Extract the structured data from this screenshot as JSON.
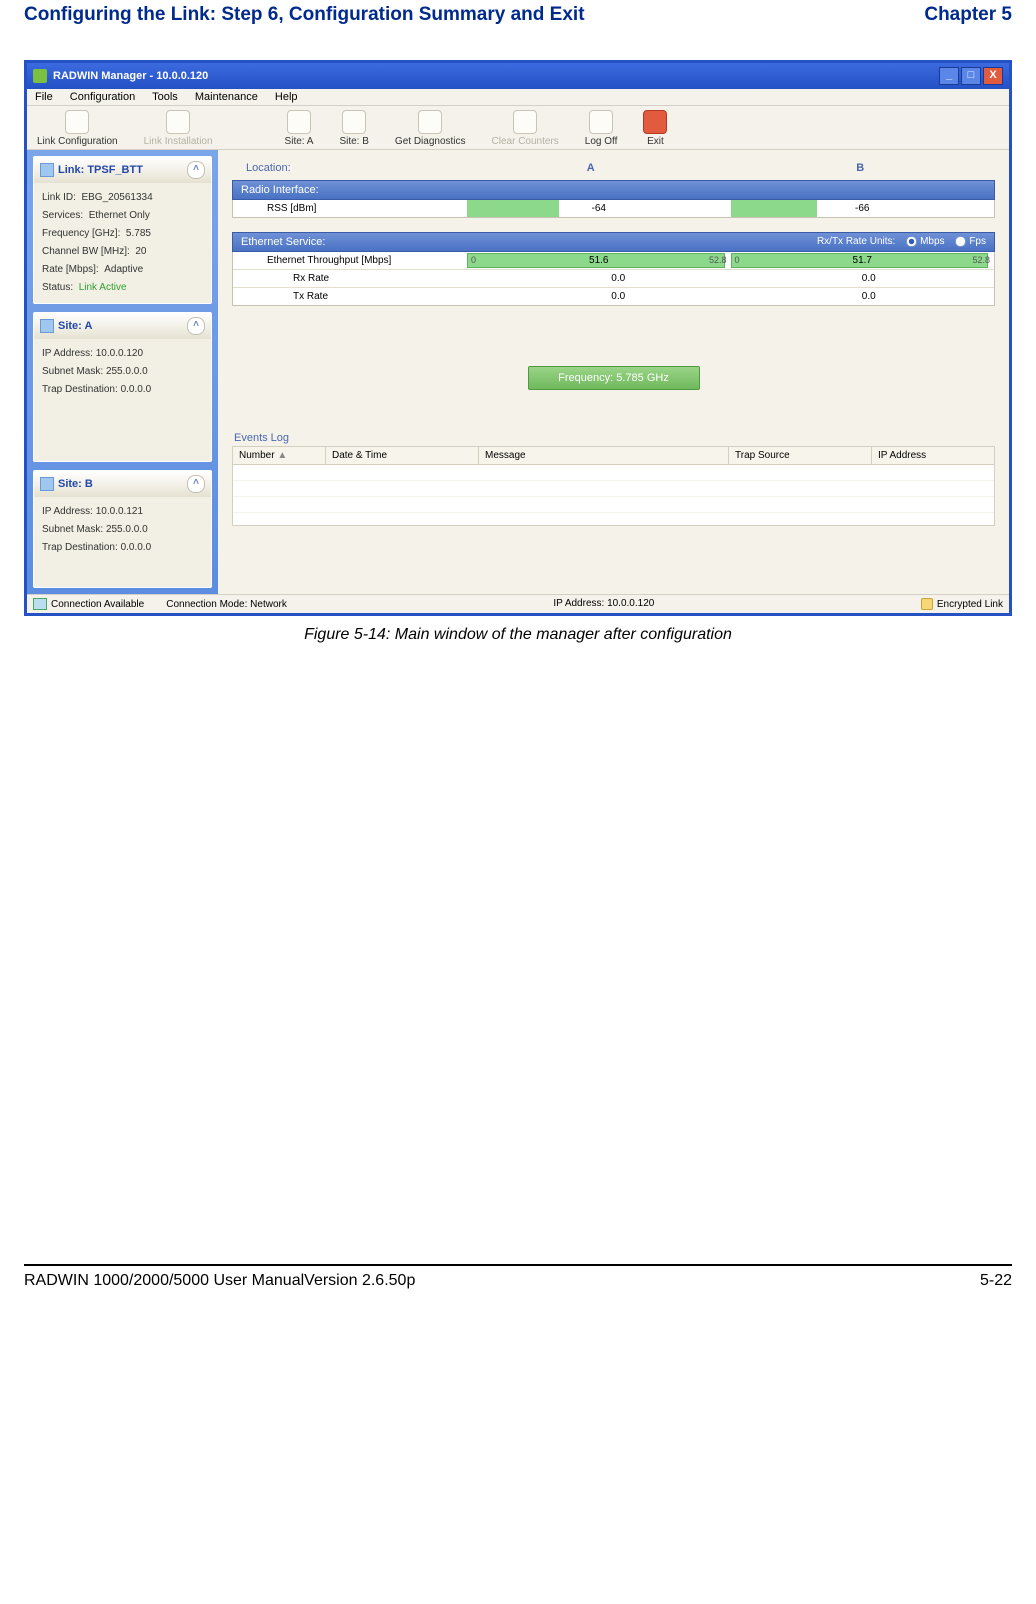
{
  "header": {
    "left": "Configuring the Link: Step 6, Configuration Summary and Exit",
    "right": "Chapter 5"
  },
  "titlebar": {
    "text": "RADWIN Manager - 10.0.0.120"
  },
  "winbtns": {
    "min": "_",
    "max": "□",
    "close": "X"
  },
  "menu": {
    "file": "File",
    "config": "Configuration",
    "tools": "Tools",
    "maint": "Maintenance",
    "help": "Help"
  },
  "toolbar": {
    "linkconf": "Link Configuration",
    "linkinst": "Link Installation",
    "sitea": "Site: A",
    "siteb": "Site: B",
    "getdiag": "Get Diagnostics",
    "clearcnt": "Clear Counters",
    "logoff": "Log Off",
    "exit": "Exit"
  },
  "panelLink": {
    "title": "Link: TPSF_BTT",
    "rows": {
      "id_l": "Link ID:",
      "id_v": "EBG_20561334",
      "svc_l": "Services:",
      "svc_v": "Ethernet Only",
      "freq_l": "Frequency [GHz]:",
      "freq_v": "5.785",
      "bw_l": "Channel BW [MHz]:",
      "bw_v": "20",
      "rate_l": "Rate [Mbps]:",
      "rate_v": "Adaptive",
      "stat_l": "Status:",
      "stat_v": "Link Active"
    }
  },
  "panelA": {
    "title": "Site: A",
    "rows": {
      "ip_l": "IP Address:",
      "ip_v": "10.0.0.120",
      "sm_l": "Subnet Mask:",
      "sm_v": "255.0.0.0",
      "td_l": "Trap Destination:",
      "td_v": "0.0.0.0"
    }
  },
  "panelB": {
    "title": "Site: B",
    "rows": {
      "ip_l": "IP Address:",
      "ip_v": "10.0.0.121",
      "sm_l": "Subnet Mask:",
      "sm_v": "255.0.0.0",
      "td_l": "Trap Destination:",
      "td_v": "0.0.0.0"
    }
  },
  "loc": {
    "label": "Location:",
    "a": "A",
    "b": "B"
  },
  "radio": {
    "head": "Radio Interface:",
    "rss_l": "RSS [dBm]",
    "rss_a": "-64",
    "rss_b": "-66"
  },
  "eth": {
    "head": "Ethernet Service:",
    "rxlab": "Rx/Tx Rate Units:",
    "opt1": "Mbps",
    "opt2": "Fps",
    "tp_l": "Ethernet Throughput [Mbps]",
    "tp_a": "51.6",
    "tp_b": "51.7",
    "tp_a_min": "0",
    "tp_a_max": "52.8",
    "tp_b_min": "0",
    "tp_b_max": "52.8",
    "rx_l": "Rx Rate",
    "rx_a": "0.0",
    "rx_b": "0.0",
    "tx_l": "Tx Rate",
    "tx_a": "0.0",
    "tx_b": "0.0"
  },
  "freqbtn": "Frequency: 5.785 GHz",
  "events": {
    "head": "Events Log",
    "c1": "Number",
    "c2": "Date & Time",
    "c3": "Message",
    "c4": "Trap Source",
    "c5": "IP Address"
  },
  "status": {
    "conn": "Connection Available",
    "mode": "Connection Mode: Network",
    "ip": "IP Address: 10.0.0.120",
    "enc": "Encrypted Link"
  },
  "caption": "Figure 5-14: Main window of the manager after configuration",
  "footer": {
    "left": "RADWIN 1000/2000/5000 User ManualVersion  2.6.50p",
    "right": "5-22"
  }
}
